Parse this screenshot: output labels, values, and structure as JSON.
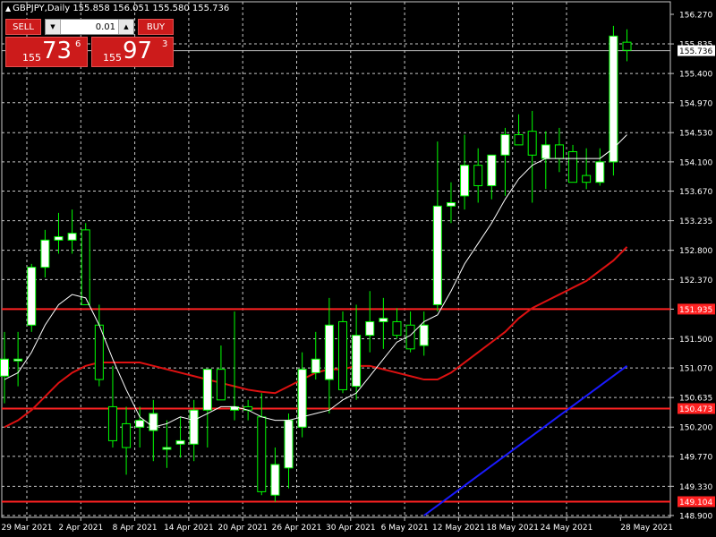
{
  "header": {
    "arrow_icon": "triangle-up-icon",
    "text": "GBPJPY,Daily  155.858 156.051 155.580 155.736"
  },
  "trade_panel": {
    "sell_label": "SELL",
    "buy_label": "BUY",
    "lot_value": "0.01",
    "sell_quote": {
      "prefix": "155",
      "big": "73",
      "sup": "6"
    },
    "buy_quote": {
      "prefix": "155",
      "big": "97",
      "sup": "3"
    }
  },
  "colors": {
    "background": "#000000",
    "grid": "#c8c8c8",
    "bull_body": "#ffffff",
    "bear_body": "#000000",
    "bull_wick": "#00ff00",
    "ma_fast": "#ffffff",
    "ma_mid": "#dd1111",
    "ma_slow": "#1a1aff",
    "hline": "#ff2222",
    "ask_line": "#c0c0c0",
    "axis_text": "#ffffff"
  },
  "chart_data": {
    "type": "candlestick",
    "symbol": "GBPJPY",
    "timeframe": "Daily",
    "x_tick_labels": [
      "29 Mar 2021",
      "2 Apr 2021",
      "8 Apr 2021",
      "14 Apr 2021",
      "20 Apr 2021",
      "26 Apr 2021",
      "30 Apr 2021",
      "6 May 2021",
      "12 May 2021",
      "18 May 2021",
      "24 May 2021",
      "28 May 2021"
    ],
    "y_tick_labels": [
      "156.270",
      "155.835",
      "155.400",
      "154.970",
      "154.530",
      "154.100",
      "153.670",
      "153.235",
      "152.800",
      "152.370",
      "151.935",
      "151.500",
      "151.070",
      "150.635",
      "150.200",
      "149.770",
      "149.330",
      "148.900"
    ],
    "ylim": [
      148.9,
      156.27
    ],
    "horizontal_lines": [
      {
        "price": 151.935,
        "label": "151.935"
      },
      {
        "price": 150.473,
        "label": "150.473"
      },
      {
        "price": 149.104,
        "label": "149.104"
      }
    ],
    "current_price": {
      "price": 155.736,
      "label": "155.736"
    },
    "candles": [
      {
        "o": 150.95,
        "h": 151.6,
        "l": 150.55,
        "c": 151.2
      },
      {
        "o": 151.2,
        "h": 151.6,
        "l": 150.8,
        "c": 151.2
      },
      {
        "o": 151.7,
        "h": 152.6,
        "l": 151.6,
        "c": 152.55
      },
      {
        "o": 152.55,
        "h": 153.1,
        "l": 152.4,
        "c": 152.95
      },
      {
        "o": 152.95,
        "h": 153.35,
        "l": 152.75,
        "c": 153.0
      },
      {
        "o": 152.95,
        "h": 153.4,
        "l": 152.75,
        "c": 153.05
      },
      {
        "o": 153.1,
        "h": 153.2,
        "l": 152.0,
        "c": 152.0
      },
      {
        "o": 151.7,
        "h": 152.0,
        "l": 150.8,
        "c": 150.9
      },
      {
        "o": 150.5,
        "h": 151.1,
        "l": 149.9,
        "c": 150.0
      },
      {
        "o": 150.25,
        "h": 150.5,
        "l": 149.5,
        "c": 149.9
      },
      {
        "o": 150.2,
        "h": 150.5,
        "l": 149.9,
        "c": 150.3
      },
      {
        "o": 150.15,
        "h": 150.6,
        "l": 149.7,
        "c": 150.4
      },
      {
        "o": 149.9,
        "h": 150.3,
        "l": 149.6,
        "c": 149.9
      },
      {
        "o": 149.95,
        "h": 150.35,
        "l": 149.75,
        "c": 150.0
      },
      {
        "o": 149.95,
        "h": 150.6,
        "l": 149.7,
        "c": 150.45
      },
      {
        "o": 150.45,
        "h": 151.0,
        "l": 149.9,
        "c": 151.05
      },
      {
        "o": 151.05,
        "h": 151.4,
        "l": 150.6,
        "c": 150.6
      },
      {
        "o": 150.45,
        "h": 151.9,
        "l": 150.3,
        "c": 150.5
      },
      {
        "o": 150.5,
        "h": 150.6,
        "l": 150.3,
        "c": 150.45
      },
      {
        "o": 150.35,
        "h": 150.7,
        "l": 149.2,
        "c": 149.25
      },
      {
        "o": 149.2,
        "h": 149.9,
        "l": 149.1,
        "c": 149.65
      },
      {
        "o": 149.6,
        "h": 150.4,
        "l": 149.3,
        "c": 150.3
      },
      {
        "o": 150.2,
        "h": 151.3,
        "l": 150.05,
        "c": 151.05
      },
      {
        "o": 151.0,
        "h": 151.6,
        "l": 150.9,
        "c": 151.2
      },
      {
        "o": 150.9,
        "h": 152.1,
        "l": 150.4,
        "c": 151.7
      },
      {
        "o": 151.75,
        "h": 151.9,
        "l": 150.7,
        "c": 150.75
      },
      {
        "o": 150.8,
        "h": 152.0,
        "l": 150.6,
        "c": 151.55
      },
      {
        "o": 151.55,
        "h": 152.2,
        "l": 151.3,
        "c": 151.75
      },
      {
        "o": 151.75,
        "h": 152.1,
        "l": 151.35,
        "c": 151.8
      },
      {
        "o": 151.75,
        "h": 151.95,
        "l": 151.5,
        "c": 151.55
      },
      {
        "o": 151.7,
        "h": 151.9,
        "l": 151.3,
        "c": 151.35
      },
      {
        "o": 151.4,
        "h": 151.9,
        "l": 151.25,
        "c": 151.7
      },
      {
        "o": 152.0,
        "h": 154.4,
        "l": 151.9,
        "c": 153.45
      },
      {
        "o": 153.45,
        "h": 153.8,
        "l": 153.2,
        "c": 153.5
      },
      {
        "o": 153.6,
        "h": 154.5,
        "l": 153.4,
        "c": 154.05
      },
      {
        "o": 154.05,
        "h": 154.3,
        "l": 153.5,
        "c": 153.75
      },
      {
        "o": 153.75,
        "h": 154.2,
        "l": 153.55,
        "c": 154.2
      },
      {
        "o": 154.2,
        "h": 154.6,
        "l": 153.6,
        "c": 154.5
      },
      {
        "o": 154.5,
        "h": 154.8,
        "l": 154.35,
        "c": 154.35
      },
      {
        "o": 154.55,
        "h": 154.85,
        "l": 153.5,
        "c": 154.2
      },
      {
        "o": 154.15,
        "h": 154.55,
        "l": 153.7,
        "c": 154.35
      },
      {
        "o": 154.35,
        "h": 154.6,
        "l": 153.95,
        "c": 154.15
      },
      {
        "o": 154.25,
        "h": 154.35,
        "l": 153.8,
        "c": 153.8
      },
      {
        "o": 153.9,
        "h": 154.3,
        "l": 153.7,
        "c": 153.8
      },
      {
        "o": 153.8,
        "h": 154.3,
        "l": 153.75,
        "c": 154.1
      },
      {
        "o": 154.1,
        "h": 156.1,
        "l": 153.9,
        "c": 155.95
      },
      {
        "o": 155.86,
        "h": 156.05,
        "l": 155.58,
        "c": 155.74
      }
    ],
    "ma_fast_values": [
      150.9,
      151.0,
      151.3,
      151.7,
      152.0,
      152.15,
      152.1,
      151.7,
      151.2,
      150.75,
      150.35,
      150.2,
      150.25,
      150.35,
      150.3,
      150.4,
      150.5,
      150.5,
      150.45,
      150.35,
      150.3,
      150.3,
      150.35,
      150.4,
      150.45,
      150.6,
      150.7,
      150.95,
      151.2,
      151.45,
      151.55,
      151.75,
      151.85,
      152.2,
      152.6,
      152.9,
      153.2,
      153.55,
      153.85,
      154.05,
      154.15,
      154.15,
      154.15,
      154.15,
      154.15,
      154.3,
      154.5
    ],
    "ma_mid_values": [
      150.2,
      150.3,
      150.45,
      150.65,
      150.85,
      151.0,
      151.1,
      151.15,
      151.15,
      151.15,
      151.15,
      151.1,
      151.05,
      151.0,
      150.95,
      150.9,
      150.85,
      150.8,
      150.75,
      150.72,
      150.7,
      150.8,
      150.9,
      151.0,
      151.05,
      151.05,
      151.1,
      151.1,
      151.05,
      151.0,
      150.95,
      150.9,
      150.9,
      151.0,
      151.15,
      151.3,
      151.45,
      151.6,
      151.8,
      151.95,
      152.05,
      152.15,
      152.25,
      152.35,
      152.5,
      152.65,
      152.85
    ],
    "ma_slow": {
      "start_index": 31,
      "start_value": 148.9,
      "end_index": 46,
      "end_value": 151.1
    }
  }
}
